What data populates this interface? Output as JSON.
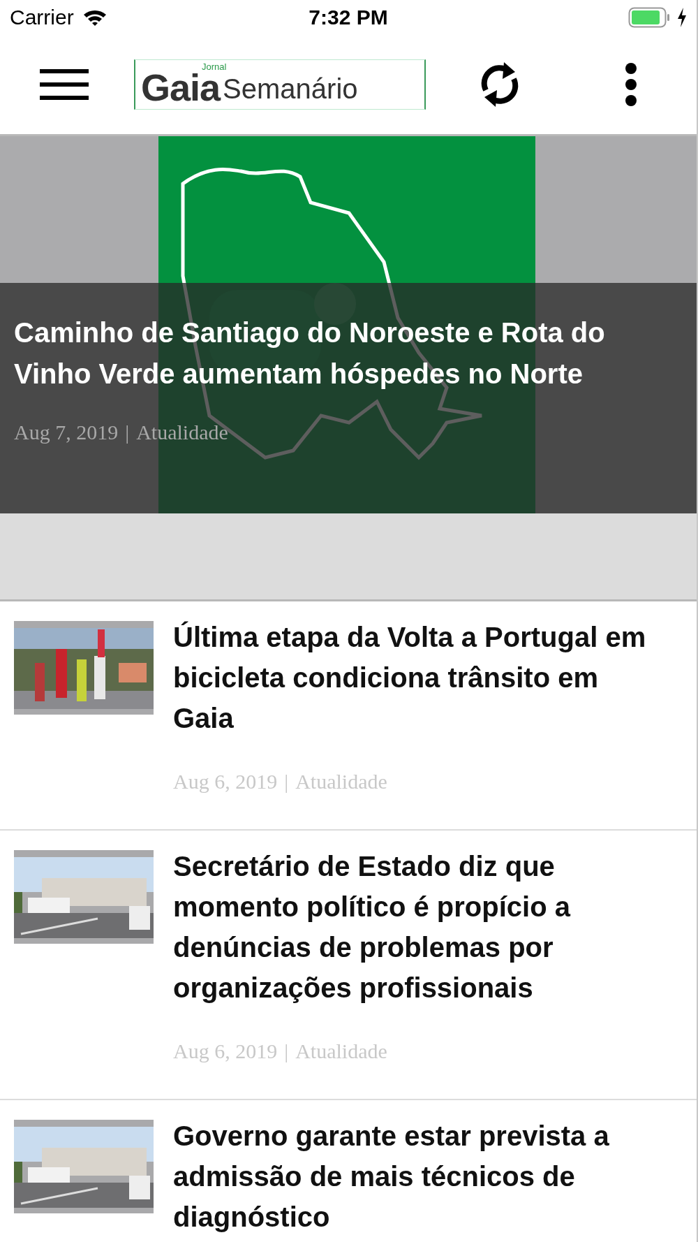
{
  "status_bar": {
    "carrier": "Carrier",
    "time": "7:32 PM"
  },
  "nav_bar": {
    "logo": {
      "small": "Jornal",
      "main": "Gaia",
      "sub": "Semanário"
    }
  },
  "featured": {
    "kind": "picture",
    "title": "Caminho de Santiago do Noroeste e Rota do Vinho Verde aumentam hóspedes no Norte",
    "date": "Aug 7, 2019",
    "separator": "|",
    "category": "Atualidade"
  },
  "articles": [
    {
      "kind": "picture",
      "title": "Última etapa da Volta a Portugal em bicicleta condiciona trânsito em Gaia",
      "date": "Aug 6, 2019",
      "separator": "|",
      "category": "Atualidade"
    },
    {
      "kind": "picture",
      "title": "Secretário de Estado diz que momento político é propício a denúncias de problemas por organizações profissionais",
      "date": "Aug 6, 2019",
      "separator": "|",
      "category": "Atualidade"
    },
    {
      "kind": "picture",
      "title": "Governo garante estar prevista a admissão de mais técnicos de diagnóstico"
    }
  ]
}
